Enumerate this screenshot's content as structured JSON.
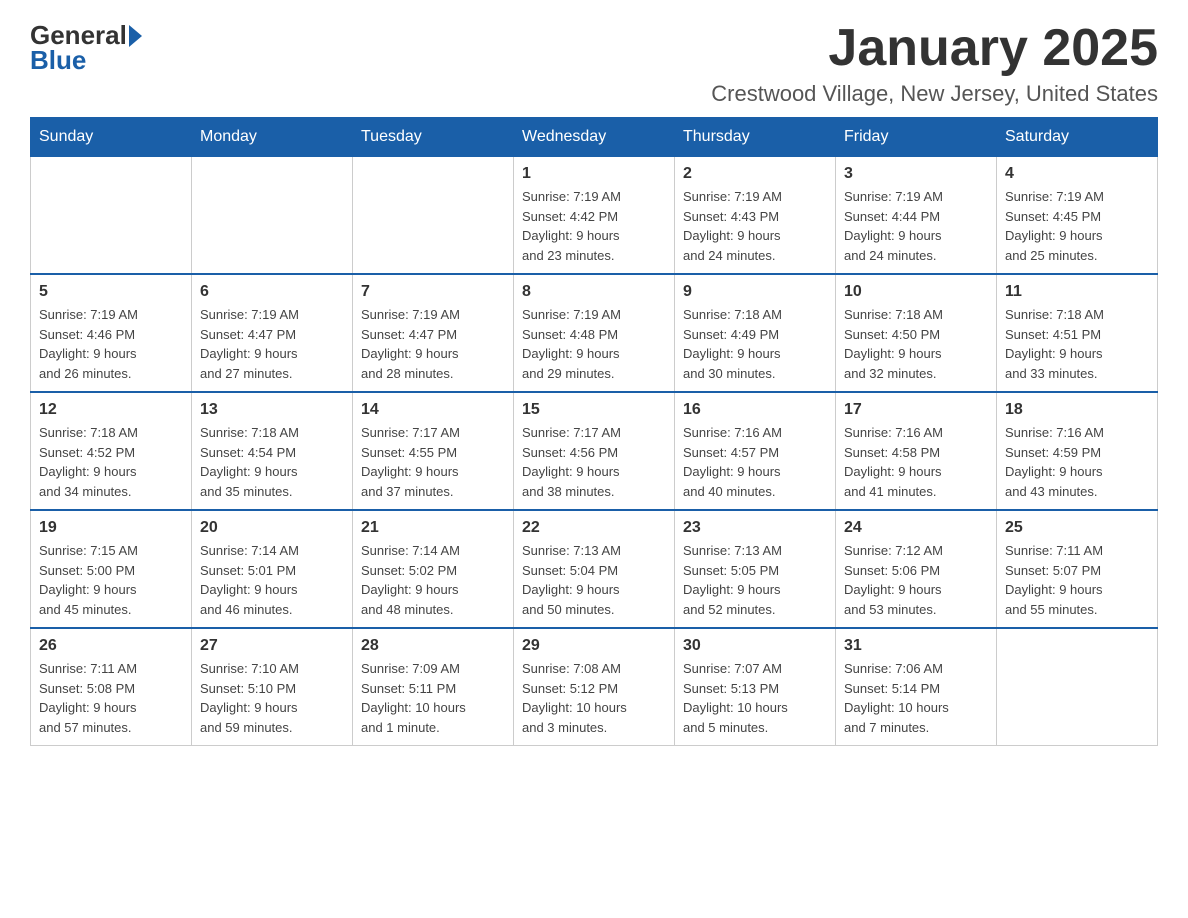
{
  "header": {
    "logo_general": "General",
    "logo_blue": "Blue",
    "month_title": "January 2025",
    "location": "Crestwood Village, New Jersey, United States"
  },
  "days_of_week": [
    "Sunday",
    "Monday",
    "Tuesday",
    "Wednesday",
    "Thursday",
    "Friday",
    "Saturday"
  ],
  "weeks": [
    [
      {
        "day": "",
        "info": ""
      },
      {
        "day": "",
        "info": ""
      },
      {
        "day": "",
        "info": ""
      },
      {
        "day": "1",
        "info": "Sunrise: 7:19 AM\nSunset: 4:42 PM\nDaylight: 9 hours\nand 23 minutes."
      },
      {
        "day": "2",
        "info": "Sunrise: 7:19 AM\nSunset: 4:43 PM\nDaylight: 9 hours\nand 24 minutes."
      },
      {
        "day": "3",
        "info": "Sunrise: 7:19 AM\nSunset: 4:44 PM\nDaylight: 9 hours\nand 24 minutes."
      },
      {
        "day": "4",
        "info": "Sunrise: 7:19 AM\nSunset: 4:45 PM\nDaylight: 9 hours\nand 25 minutes."
      }
    ],
    [
      {
        "day": "5",
        "info": "Sunrise: 7:19 AM\nSunset: 4:46 PM\nDaylight: 9 hours\nand 26 minutes."
      },
      {
        "day": "6",
        "info": "Sunrise: 7:19 AM\nSunset: 4:47 PM\nDaylight: 9 hours\nand 27 minutes."
      },
      {
        "day": "7",
        "info": "Sunrise: 7:19 AM\nSunset: 4:47 PM\nDaylight: 9 hours\nand 28 minutes."
      },
      {
        "day": "8",
        "info": "Sunrise: 7:19 AM\nSunset: 4:48 PM\nDaylight: 9 hours\nand 29 minutes."
      },
      {
        "day": "9",
        "info": "Sunrise: 7:18 AM\nSunset: 4:49 PM\nDaylight: 9 hours\nand 30 minutes."
      },
      {
        "day": "10",
        "info": "Sunrise: 7:18 AM\nSunset: 4:50 PM\nDaylight: 9 hours\nand 32 minutes."
      },
      {
        "day": "11",
        "info": "Sunrise: 7:18 AM\nSunset: 4:51 PM\nDaylight: 9 hours\nand 33 minutes."
      }
    ],
    [
      {
        "day": "12",
        "info": "Sunrise: 7:18 AM\nSunset: 4:52 PM\nDaylight: 9 hours\nand 34 minutes."
      },
      {
        "day": "13",
        "info": "Sunrise: 7:18 AM\nSunset: 4:54 PM\nDaylight: 9 hours\nand 35 minutes."
      },
      {
        "day": "14",
        "info": "Sunrise: 7:17 AM\nSunset: 4:55 PM\nDaylight: 9 hours\nand 37 minutes."
      },
      {
        "day": "15",
        "info": "Sunrise: 7:17 AM\nSunset: 4:56 PM\nDaylight: 9 hours\nand 38 minutes."
      },
      {
        "day": "16",
        "info": "Sunrise: 7:16 AM\nSunset: 4:57 PM\nDaylight: 9 hours\nand 40 minutes."
      },
      {
        "day": "17",
        "info": "Sunrise: 7:16 AM\nSunset: 4:58 PM\nDaylight: 9 hours\nand 41 minutes."
      },
      {
        "day": "18",
        "info": "Sunrise: 7:16 AM\nSunset: 4:59 PM\nDaylight: 9 hours\nand 43 minutes."
      }
    ],
    [
      {
        "day": "19",
        "info": "Sunrise: 7:15 AM\nSunset: 5:00 PM\nDaylight: 9 hours\nand 45 minutes."
      },
      {
        "day": "20",
        "info": "Sunrise: 7:14 AM\nSunset: 5:01 PM\nDaylight: 9 hours\nand 46 minutes."
      },
      {
        "day": "21",
        "info": "Sunrise: 7:14 AM\nSunset: 5:02 PM\nDaylight: 9 hours\nand 48 minutes."
      },
      {
        "day": "22",
        "info": "Sunrise: 7:13 AM\nSunset: 5:04 PM\nDaylight: 9 hours\nand 50 minutes."
      },
      {
        "day": "23",
        "info": "Sunrise: 7:13 AM\nSunset: 5:05 PM\nDaylight: 9 hours\nand 52 minutes."
      },
      {
        "day": "24",
        "info": "Sunrise: 7:12 AM\nSunset: 5:06 PM\nDaylight: 9 hours\nand 53 minutes."
      },
      {
        "day": "25",
        "info": "Sunrise: 7:11 AM\nSunset: 5:07 PM\nDaylight: 9 hours\nand 55 minutes."
      }
    ],
    [
      {
        "day": "26",
        "info": "Sunrise: 7:11 AM\nSunset: 5:08 PM\nDaylight: 9 hours\nand 57 minutes."
      },
      {
        "day": "27",
        "info": "Sunrise: 7:10 AM\nSunset: 5:10 PM\nDaylight: 9 hours\nand 59 minutes."
      },
      {
        "day": "28",
        "info": "Sunrise: 7:09 AM\nSunset: 5:11 PM\nDaylight: 10 hours\nand 1 minute."
      },
      {
        "day": "29",
        "info": "Sunrise: 7:08 AM\nSunset: 5:12 PM\nDaylight: 10 hours\nand 3 minutes."
      },
      {
        "day": "30",
        "info": "Sunrise: 7:07 AM\nSunset: 5:13 PM\nDaylight: 10 hours\nand 5 minutes."
      },
      {
        "day": "31",
        "info": "Sunrise: 7:06 AM\nSunset: 5:14 PM\nDaylight: 10 hours\nand 7 minutes."
      },
      {
        "day": "",
        "info": ""
      }
    ]
  ]
}
